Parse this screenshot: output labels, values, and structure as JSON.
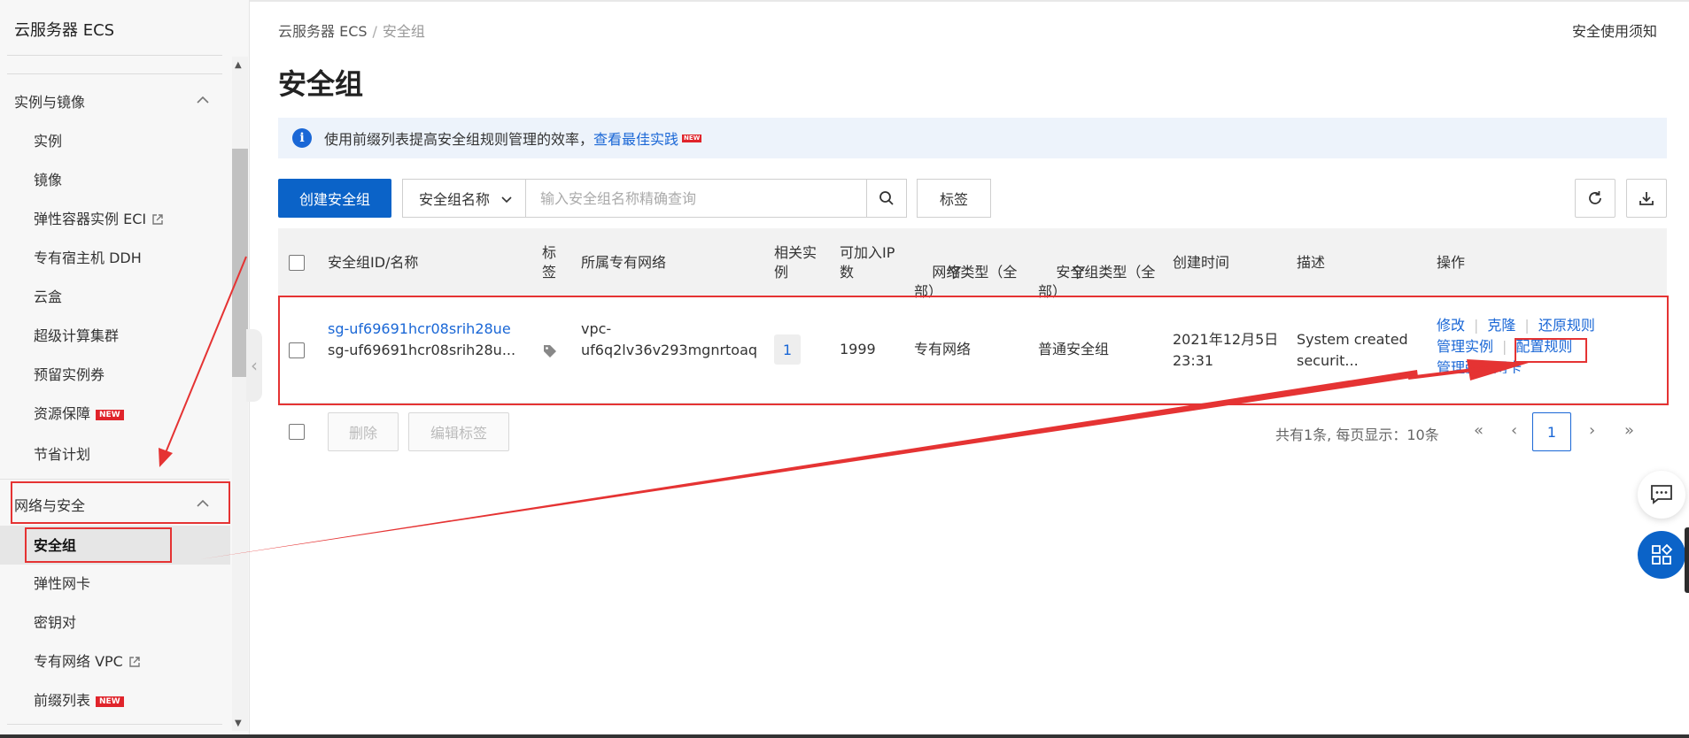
{
  "sidebar": {
    "title": "云服务器 ECS",
    "groups": [
      {
        "label": "实例与镜像"
      },
      {
        "label": "网络与安全"
      }
    ],
    "items": [
      {
        "label": "实例"
      },
      {
        "label": "镜像"
      },
      {
        "label": "弹性容器实例 ECI"
      },
      {
        "label": "专有宿主机 DDH"
      },
      {
        "label": "云盒"
      },
      {
        "label": "超级计算集群"
      },
      {
        "label": "预留实例券"
      },
      {
        "label": "资源保障",
        "badge": "NEW"
      },
      {
        "label": "节省计划"
      },
      {
        "label": "安全组"
      },
      {
        "label": "弹性网卡"
      },
      {
        "label": "密钥对"
      },
      {
        "label": "专有网络 VPC"
      },
      {
        "label": "前缀列表",
        "badge": "NEW"
      }
    ]
  },
  "header": {
    "breadcrumb": [
      "云服务器 ECS",
      "安全组"
    ],
    "breadcrumb_sep": "/",
    "notice_link": "安全使用须知",
    "title": "安全组"
  },
  "info": {
    "text": "使用前缀列表提高安全组规则管理的效率，",
    "link": "查看最佳实践",
    "badge": "NEW"
  },
  "toolbar": {
    "create_label": "创建安全组",
    "filter_select": "安全组名称",
    "search_placeholder": "输入安全组名称精确查询",
    "tag_label": "标签"
  },
  "table": {
    "columns": [
      {
        "label": "安全组ID/名称"
      },
      {
        "label": "标\n签"
      },
      {
        "label": "所属专有网络"
      },
      {
        "label": "相关实\n例"
      },
      {
        "label": "可加入IP\n数"
      },
      {
        "label": "网络类型（全\n部）"
      },
      {
        "label": "安全组类型（全\n部）"
      },
      {
        "label": "创建时间"
      },
      {
        "label": "描述"
      },
      {
        "label": "操作"
      }
    ],
    "rows": [
      {
        "id": "sg-uf69691hcr08srih28ue",
        "name": "sg-uf69691hcr08srih28u...",
        "vpc_line1": "vpc-",
        "vpc_line2": "uf6q2lv36v293mgnrtoaq",
        "instances": "1",
        "ip_capacity": "1999",
        "network_type": "专有网络",
        "sg_type": "普通安全组",
        "created_date": "2021年12月5日",
        "created_time": "23:31",
        "desc_line1": "System created",
        "desc_line2": "securit...",
        "actions_row1": [
          "修改",
          "克隆",
          "还原规则"
        ],
        "actions_row2": [
          "管理实例",
          "配置规则"
        ],
        "actions_row3": "管理弹性网卡"
      }
    ]
  },
  "footer": {
    "delete_label": "删除",
    "edit_tags_label": "编辑标签",
    "pager_text": "共有1条, 每页显示：10条",
    "first": "«",
    "prev": "‹",
    "current_page": "1",
    "next": "›",
    "last": "»"
  },
  "colors": {
    "primary": "#0b63c8",
    "link": "#1a67d6",
    "annotation": "#e53333",
    "badge": "#e0242b"
  }
}
